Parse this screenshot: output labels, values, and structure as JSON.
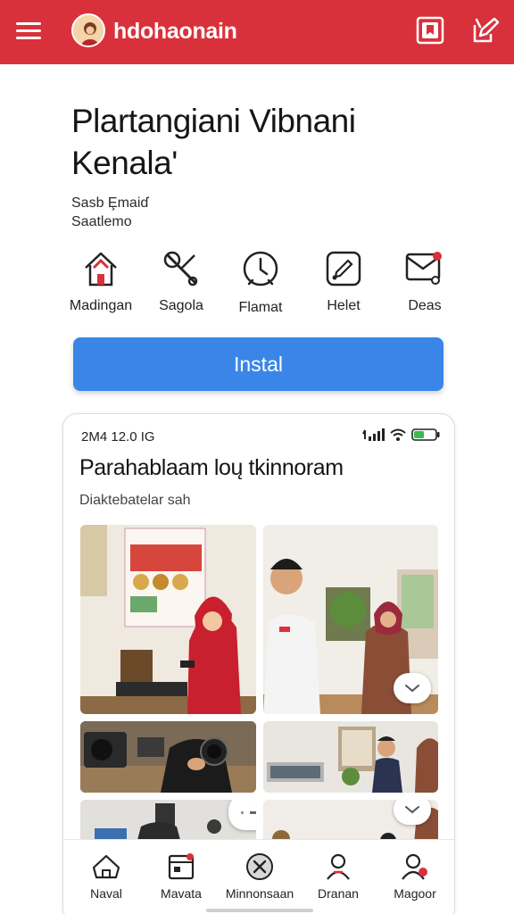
{
  "header": {
    "app_name": "hdohaonain",
    "menu_icon": "hamburger-menu-icon",
    "logo_icon": "avatar-logo-icon",
    "action_icons": [
      "bookmark-icon",
      "edit-icon"
    ],
    "brand_color": "#d9313b"
  },
  "page": {
    "title_line1": "Plartangiani Vibnani",
    "title_line2": "Kenala'",
    "subtitle_line1": "Sasb Ȩmaiɗ",
    "subtitle_line2": "Saatlemo"
  },
  "quick_actions": [
    {
      "label": "Madingan",
      "icon": "home-icon"
    },
    {
      "label": "Sagola",
      "icon": "tools-icon"
    },
    {
      "label": "Flamat",
      "icon": "clock-icon"
    },
    {
      "label": "Helet",
      "icon": "edit-box-icon"
    },
    {
      "label": "Deas",
      "icon": "mail-icon"
    }
  ],
  "install_button": {
    "label": "Instal",
    "color": "#3a86e8"
  },
  "phone_preview": {
    "status_time": "2M4 12.0 IG",
    "title": "Parahablaam loų tkinnoram",
    "subtitle": "Diaktebatelar sah",
    "photos": [
      "presentation-hijab-woman-photo",
      "tour-guide-and-woman-photo",
      "camera-equipment-photo",
      "office-meeting-photo",
      "classroom-photo",
      "visitors-photo"
    ],
    "bottom_nav": [
      {
        "label": "Naval",
        "icon": "house-outline-icon"
      },
      {
        "label": "Mavata",
        "icon": "calendar-icon"
      },
      {
        "label": "Minnonsaan",
        "icon": "close-circle-icon"
      },
      {
        "label": "Dranan",
        "icon": "person-icon"
      },
      {
        "label": "Magoor",
        "icon": "person-badge-icon"
      }
    ]
  }
}
